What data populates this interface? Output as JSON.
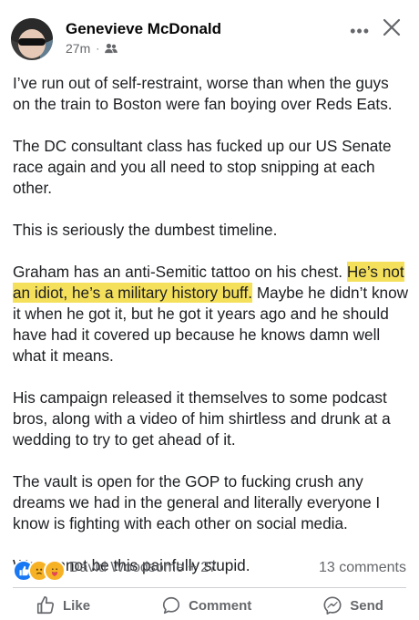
{
  "post": {
    "author": "Genevieve McDonald",
    "time": "27m",
    "dot": "·",
    "more": "•••",
    "paragraphs": [
      {
        "text": "I’ve run out of self-restraint, worse than when the guys on the train to Boston were fan boying over Reds Eats."
      },
      {
        "text": "The DC consultant class has fucked up our US Senate race again and you all need to stop snipping at each other."
      },
      {
        "text": "This is seriously the dumbest timeline."
      },
      {
        "before": "Graham has an anti-Semitic tattoo on his chest. ",
        "highlight": "He’s not an idiot, he’s a military history buff.",
        "after": " Maybe he didn’t know it when he got it, but he got it years ago and he should have had it covered up because he knows damn well what it means."
      },
      {
        "text": "His campaign released it themselves to some podcast bros, along with a video of him shirtless and drunk at a wedding to try to get ahead of it."
      },
      {
        "text": "The vault is open for the GOP to fucking crush any dreams we had in the general and literally everyone I know is fighting with each other on social media."
      },
      {
        "text": "We cannot be this painfully stupid."
      }
    ],
    "highlight_color": "#f5e05c"
  },
  "reactions": {
    "names": "David Woodsome + 27",
    "comments": "13 comments"
  },
  "actions": {
    "like": "Like",
    "comment": "Comment",
    "send": "Send"
  },
  "colors": {
    "text": "#1c1e21",
    "muted": "#65676b",
    "like_blue": "#1877f2"
  }
}
